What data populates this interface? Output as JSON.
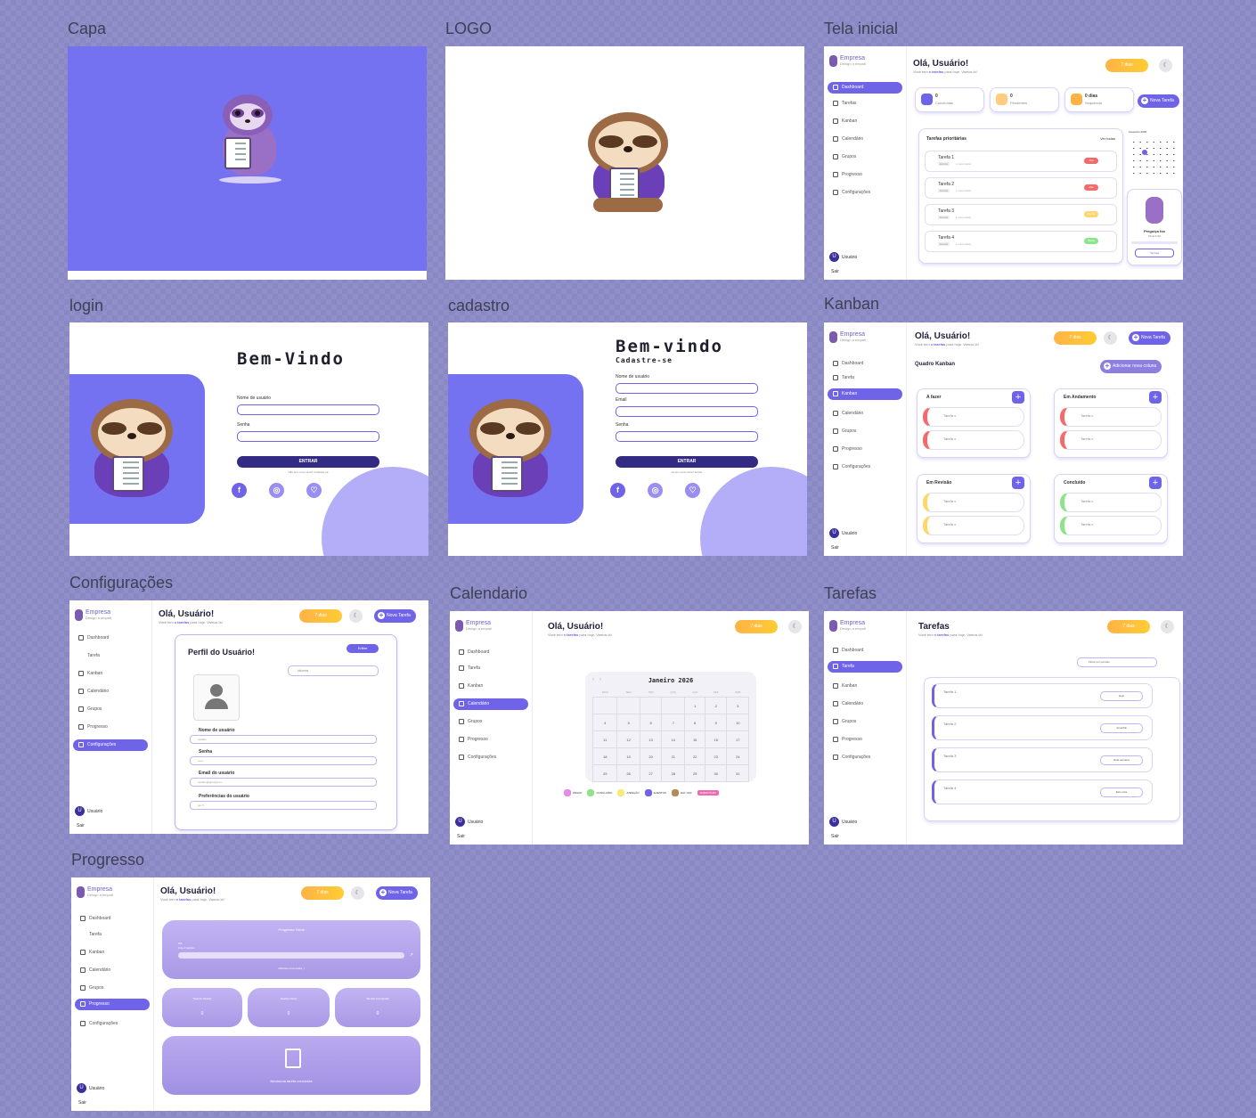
{
  "frames": {
    "capa": "Capa",
    "logo": "LOGO",
    "tela_inicial": "Tela inicial",
    "login": "login",
    "cadastro": "cadastro",
    "kanban": "Kanban",
    "configuracoes": "Configurações",
    "calendario": "Calendario",
    "tarefas": "Tarefas",
    "progresso": "Progresso"
  },
  "brand": {
    "name": "Empresa",
    "slogan": "Design a empati"
  },
  "header": {
    "greeting": "Olá, Usuário!",
    "subtitle_pre": "Você tem ",
    "subtitle_em": "x tarefas",
    "subtitle_post": " para hoje. Vamos lá!",
    "streak": "7 dias",
    "moon_icon": "☾",
    "new_task": "Nova Tarefa"
  },
  "nav": {
    "dashboard": "Dashboard",
    "tarefas": "Tarefas",
    "tarefa": "Tarefa",
    "kanban": "Kanban",
    "calendario": "Calendário",
    "grupos": "Grupos",
    "progresso": "Progresso",
    "configuracoes": "Configurações"
  },
  "user": {
    "initial": "U",
    "name": "Usuário",
    "level": "Nível 1",
    "logout": "Sair"
  },
  "dashboard": {
    "stats": [
      {
        "value": "0",
        "label": "Concluídas"
      },
      {
        "value": "0",
        "label": "Pendentes"
      },
      {
        "value": "0 dias",
        "label": "Sequência"
      }
    ],
    "priority_title": "Tarefas prioritárias",
    "see_all": "Ver todas",
    "tasks": [
      {
        "name": "Tarefa 1",
        "tag": "Escola",
        "meta": "1 comentário",
        "badge": "Alta",
        "color": "#f46a6a"
      },
      {
        "name": "Tarefa 2",
        "tag": "Escola",
        "meta": "1 comentário",
        "badge": "Alta",
        "color": "#f46a6a"
      },
      {
        "name": "Tarefa 3",
        "tag": "Escola",
        "meta": "1 comentário",
        "badge": "Média",
        "color": "#ffd66b"
      },
      {
        "name": "Tarefa 4",
        "tag": "Escola",
        "meta": "1 comentário",
        "badge": "Baixa",
        "color": "#8ee48a"
      }
    ],
    "mini_calendar_title": "Fevereiro 2026",
    "mascot_title": "Preguiça fox",
    "mascot_sub": "Nível 1/10",
    "mascot_btn": "Ver loja"
  },
  "login": {
    "title": "Bem-Vindo",
    "user_label": "Nome de usuário",
    "pass_label": "Senha",
    "button": "ENTRAR",
    "footer": "Não tem uma conta? Cadastre-se",
    "social": [
      "f",
      "◎",
      "♡"
    ]
  },
  "cadastro": {
    "title": "Bem-vindo",
    "subtitle": "Cadastre-se",
    "user_label": "Nome de usuário",
    "email_label": "Email",
    "pass_label": "Senha",
    "button": "ENTRAR",
    "footer": "Já tem uma conta? Entrar"
  },
  "kanban": {
    "title": "Quadro Kanban",
    "add_column": "Adicionar nova coluna",
    "columns": [
      {
        "name": "A fazer",
        "color": "#f46a6a",
        "cards": [
          "Tarefa x",
          "Tarefa x"
        ]
      },
      {
        "name": "Em Andamento",
        "color": "#f46a6a",
        "cards": [
          "Tarefa x",
          "Tarefa x"
        ]
      },
      {
        "name": "Em Revisão",
        "color": "#ffd66b",
        "cards": [
          "Tarefa x",
          "Tarefa x"
        ]
      },
      {
        "name": "Concluído",
        "color": "#8ee48a",
        "cards": [
          "Tarefa x",
          "Tarefa x"
        ]
      }
    ]
  },
  "config": {
    "title": "Perfil do Usuário!",
    "edit": "Editar",
    "select": "Idioma",
    "fields": [
      {
        "label": "Nome de usuário",
        "value": "usuário"
      },
      {
        "label": "Senha",
        "value": "••••••"
      },
      {
        "label": "Email do usuário",
        "value": "usuario@gmail.com"
      },
      {
        "label": "Preferências do usuário",
        "value": "por X"
      }
    ]
  },
  "calendar": {
    "month": "Janeiro 2026",
    "weekdays": [
      "DOM",
      "SEG",
      "TER",
      "QUA",
      "QUI",
      "SEX",
      "SAB"
    ],
    "rows": [
      [
        "",
        "",
        "",
        "",
        "1",
        "2",
        "3"
      ],
      [
        "4",
        "5",
        "6",
        "7",
        "8",
        "9",
        "10"
      ],
      [
        "11",
        "12",
        "13",
        "14",
        "15",
        "16",
        "17"
      ],
      [
        "18",
        "19",
        "20",
        "21",
        "22",
        "23",
        "24"
      ],
      [
        "25",
        "26",
        "27",
        "28",
        "29",
        "30",
        "31"
      ]
    ],
    "legend": [
      {
        "label": "PRAZO",
        "color": "#e58ae8"
      },
      {
        "label": "CONCLUÍDO",
        "color": "#8ee48a"
      },
      {
        "label": "ATENÇÃO",
        "color": "#f5ea7a"
      },
      {
        "label": "EVENTOS",
        "color": "#6f63e8"
      },
      {
        "label": "DAY OFF",
        "color": "#b58a5a"
      }
    ],
    "tag": "SUBSTITUIR"
  },
  "tarefas": {
    "title": "Tarefas",
    "filter": "Filtrar por período",
    "items": [
      {
        "name": "Tarefa 1",
        "btn": "Hoje"
      },
      {
        "name": "Tarefa 2",
        "btn": "Amanhã"
      },
      {
        "name": "Tarefa 3",
        "btn": "Esta semana"
      },
      {
        "name": "Tarefa 4",
        "btn": "Este mês"
      }
    ]
  },
  "progresso": {
    "card_title": "Progresso Geral",
    "bar_label": "0%",
    "bar_sub": "0 de 0 tarefas",
    "bar_value": 0,
    "bar_footer": "Adicione uma tarefa :)",
    "stats": [
      {
        "label": "Total de Tarefas",
        "value": "0"
      },
      {
        "label": "Tarefas Ativas",
        "value": "0"
      },
      {
        "label": "Tarefas Concluídas",
        "value": "0"
      }
    ],
    "empty": "Nenhuma tarefa concluída"
  },
  "colors": {
    "accent": "#6f63e8",
    "cover": "#7472f0",
    "dark": "#332a83"
  }
}
